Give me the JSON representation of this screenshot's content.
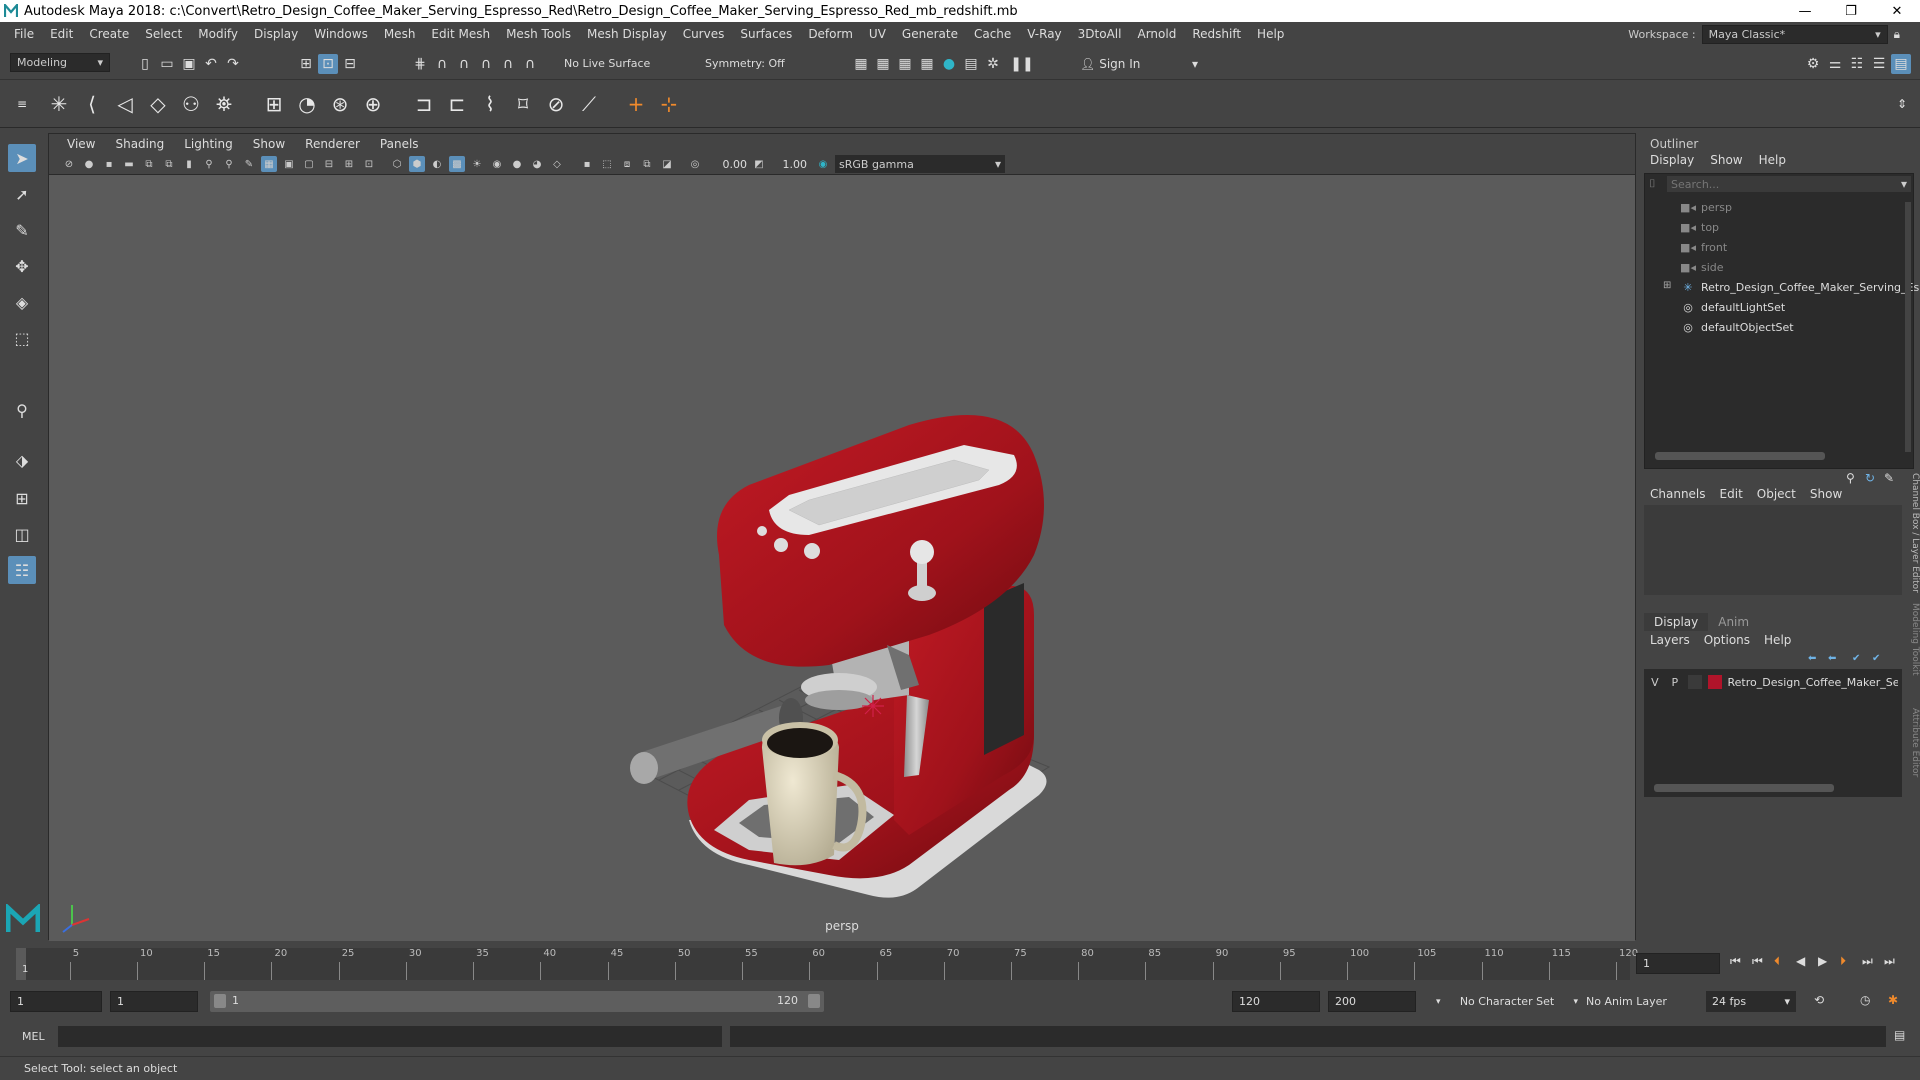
{
  "window": {
    "title": "Autodesk Maya 2018: c:\\Convert\\Retro_Design_Coffee_Maker_Serving_Espresso_Red\\Retro_Design_Coffee_Maker_Serving_Espresso_Red_mb_redshift.mb",
    "minimize": "—",
    "maximize": "❐",
    "close": "✕"
  },
  "menubar": {
    "items": [
      "File",
      "Edit",
      "Create",
      "Select",
      "Modify",
      "Display",
      "Windows",
      "Mesh",
      "Edit Mesh",
      "Mesh Tools",
      "Mesh Display",
      "Curves",
      "Surfaces",
      "Deform",
      "UV",
      "Generate",
      "Cache",
      "V-Ray",
      "3DtoAll",
      "Arnold",
      "Redshift",
      "Help"
    ],
    "workspace_label": "Workspace :",
    "workspace_value": "Maya Classic*"
  },
  "statusline": {
    "mode": "Modeling",
    "live_surface": "No Live Surface",
    "symmetry": "Symmetry: Off",
    "sign_in": "Sign In"
  },
  "viewport": {
    "menus": [
      "View",
      "Shading",
      "Lighting",
      "Show",
      "Renderer",
      "Panels"
    ],
    "exposure": "0.00",
    "gamma": "1.00",
    "color_space": "sRGB gamma",
    "camera": "persp"
  },
  "outliner": {
    "title": "Outliner",
    "menus": [
      "Display",
      "Show",
      "Help"
    ],
    "search_placeholder": "Search...",
    "items": [
      {
        "label": "persp",
        "icon": "camera-icon",
        "dim": true
      },
      {
        "label": "top",
        "icon": "camera-icon",
        "dim": true
      },
      {
        "label": "front",
        "icon": "camera-icon",
        "dim": true
      },
      {
        "label": "side",
        "icon": "camera-icon",
        "dim": true
      },
      {
        "label": "Retro_Design_Coffee_Maker_Serving_Es",
        "icon": "group-icon",
        "dim": false
      },
      {
        "label": "defaultLightSet",
        "icon": "set-icon",
        "dim": false
      },
      {
        "label": "defaultObjectSet",
        "icon": "set-icon",
        "dim": false
      }
    ]
  },
  "channelbox": {
    "menus": [
      "Channels",
      "Edit",
      "Object",
      "Show"
    ],
    "side_tabs": [
      "Channel Box / Layer Editor",
      "Modeling Toolkit",
      "Attribute Editor"
    ]
  },
  "layers": {
    "tabs": [
      "Display",
      "Anim"
    ],
    "menus": [
      "Layers",
      "Options",
      "Help"
    ],
    "row": {
      "v": "V",
      "p": "P",
      "name": "Retro_Design_Coffee_Maker_Se",
      "color": "#b0142a"
    }
  },
  "timeline": {
    "ticks": [
      "5",
      "10",
      "15",
      "20",
      "25",
      "30",
      "35",
      "40",
      "45",
      "50",
      "55",
      "60",
      "65",
      "70",
      "75",
      "80",
      "85",
      "90",
      "95",
      "100",
      "105",
      "110",
      "115",
      "120"
    ],
    "current_label": "1",
    "current_frame": "1"
  },
  "range": {
    "start": "1",
    "start2": "1",
    "slider_start": "1",
    "slider_end": "120",
    "end": "120",
    "end2": "200",
    "character_set": "No Character Set",
    "anim_layer": "No Anim Layer",
    "fps": "24 fps"
  },
  "command": {
    "lang": "MEL"
  },
  "help": {
    "text": "Select Tool: select an object"
  }
}
